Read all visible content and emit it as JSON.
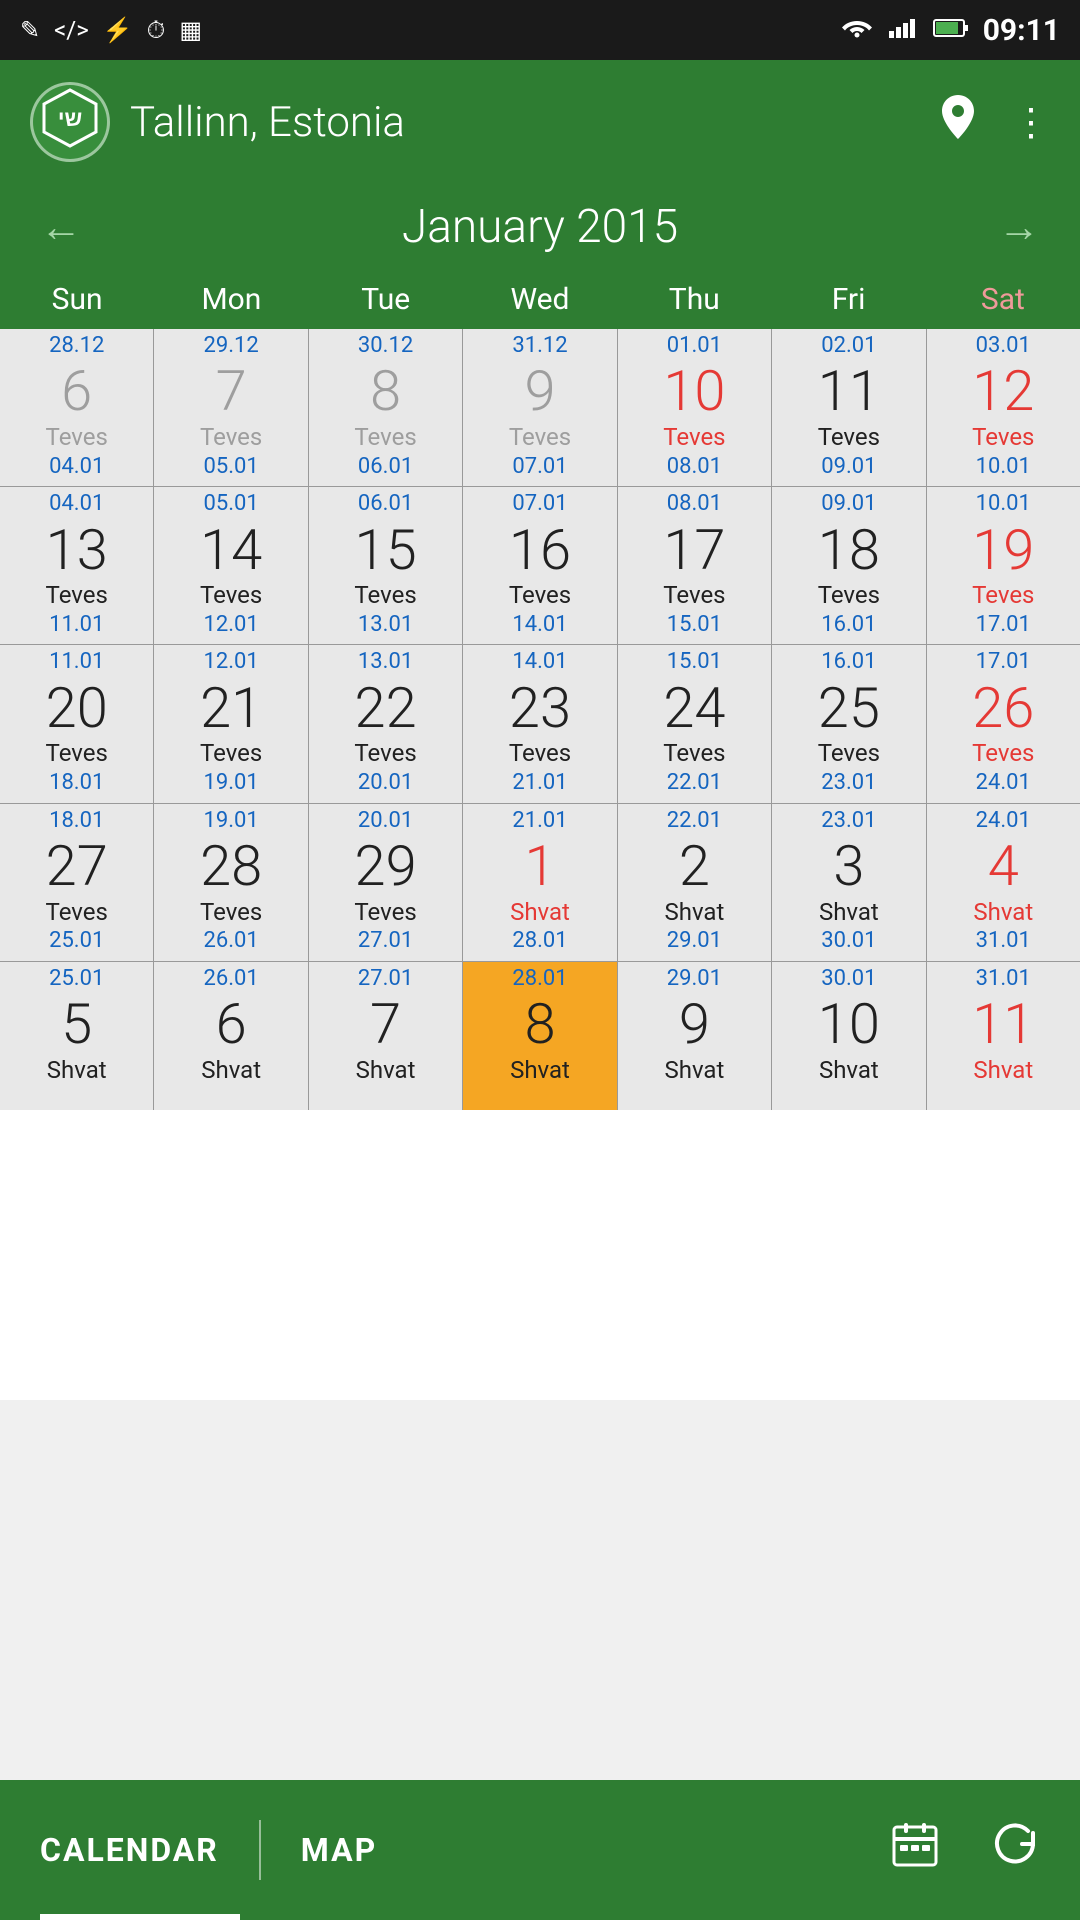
{
  "statusBar": {
    "time": "09:11",
    "leftIcons": [
      "✎",
      "</>",
      "⚡",
      "⏱",
      "▦"
    ],
    "rightIcons": [
      "wifi",
      "signal",
      "battery"
    ]
  },
  "header": {
    "city": "Tallinn, Estonia",
    "logoText": "שי"
  },
  "nav": {
    "monthTitle": "January 2015",
    "prevArrow": "←",
    "nextArrow": "→"
  },
  "dayHeaders": [
    {
      "label": "Sun",
      "class": ""
    },
    {
      "label": "Mon",
      "class": ""
    },
    {
      "label": "Tue",
      "class": ""
    },
    {
      "label": "Wed",
      "class": ""
    },
    {
      "label": "Thu",
      "class": ""
    },
    {
      "label": "Fri",
      "class": ""
    },
    {
      "label": "Sat",
      "class": "sat"
    }
  ],
  "weeks": [
    {
      "days": [
        {
          "topDate": "28.12",
          "num": "6",
          "numColor": "gray",
          "hebrew": "Teves",
          "hebColor": "gray",
          "bottomDate": "04.01",
          "isToday": false
        },
        {
          "topDate": "29.12",
          "num": "7",
          "numColor": "gray",
          "hebrew": "Teves",
          "hebColor": "gray",
          "bottomDate": "05.01",
          "isToday": false
        },
        {
          "topDate": "30.12",
          "num": "8",
          "numColor": "gray",
          "hebrew": "Teves",
          "hebColor": "gray",
          "bottomDate": "06.01",
          "isToday": false
        },
        {
          "topDate": "31.12",
          "num": "9",
          "numColor": "gray",
          "hebrew": "Teves",
          "hebColor": "gray",
          "bottomDate": "07.01",
          "isToday": false
        },
        {
          "topDate": "01.01",
          "num": "10",
          "numColor": "red",
          "hebrew": "Teves",
          "hebColor": "red",
          "bottomDate": "08.01",
          "isToday": false
        },
        {
          "topDate": "02.01",
          "num": "11",
          "numColor": "",
          "hebrew": "Teves",
          "hebColor": "",
          "bottomDate": "09.01",
          "isToday": false
        },
        {
          "topDate": "03.01",
          "num": "12",
          "numColor": "red",
          "hebrew": "Teves",
          "hebColor": "red",
          "bottomDate": "10.01",
          "isToday": false
        }
      ]
    },
    {
      "days": [
        {
          "topDate": "04.01",
          "num": "13",
          "numColor": "",
          "hebrew": "Teves",
          "hebColor": "",
          "bottomDate": "11.01",
          "isToday": false
        },
        {
          "topDate": "05.01",
          "num": "14",
          "numColor": "",
          "hebrew": "Teves",
          "hebColor": "",
          "bottomDate": "12.01",
          "isToday": false
        },
        {
          "topDate": "06.01",
          "num": "15",
          "numColor": "",
          "hebrew": "Teves",
          "hebColor": "",
          "bottomDate": "13.01",
          "isToday": false
        },
        {
          "topDate": "07.01",
          "num": "16",
          "numColor": "",
          "hebrew": "Teves",
          "hebColor": "",
          "bottomDate": "14.01",
          "isToday": false
        },
        {
          "topDate": "08.01",
          "num": "17",
          "numColor": "",
          "hebrew": "Teves",
          "hebColor": "",
          "bottomDate": "15.01",
          "isToday": false
        },
        {
          "topDate": "09.01",
          "num": "18",
          "numColor": "",
          "hebrew": "Teves",
          "hebColor": "",
          "bottomDate": "16.01",
          "isToday": false
        },
        {
          "topDate": "10.01",
          "num": "19",
          "numColor": "red",
          "hebrew": "Teves",
          "hebColor": "red",
          "bottomDate": "17.01",
          "isToday": false
        }
      ]
    },
    {
      "days": [
        {
          "topDate": "11.01",
          "num": "20",
          "numColor": "",
          "hebrew": "Teves",
          "hebColor": "",
          "bottomDate": "18.01",
          "isToday": false
        },
        {
          "topDate": "12.01",
          "num": "21",
          "numColor": "",
          "hebrew": "Teves",
          "hebColor": "",
          "bottomDate": "19.01",
          "isToday": false
        },
        {
          "topDate": "13.01",
          "num": "22",
          "numColor": "",
          "hebrew": "Teves",
          "hebColor": "",
          "bottomDate": "20.01",
          "isToday": false
        },
        {
          "topDate": "14.01",
          "num": "23",
          "numColor": "",
          "hebrew": "Teves",
          "hebColor": "",
          "bottomDate": "21.01",
          "isToday": false
        },
        {
          "topDate": "15.01",
          "num": "24",
          "numColor": "",
          "hebrew": "Teves",
          "hebColor": "",
          "bottomDate": "22.01",
          "isToday": false
        },
        {
          "topDate": "16.01",
          "num": "25",
          "numColor": "",
          "hebrew": "Teves",
          "hebColor": "",
          "bottomDate": "23.01",
          "isToday": false
        },
        {
          "topDate": "17.01",
          "num": "26",
          "numColor": "red",
          "hebrew": "Teves",
          "hebColor": "red",
          "bottomDate": "24.01",
          "isToday": false
        }
      ]
    },
    {
      "days": [
        {
          "topDate": "18.01",
          "num": "27",
          "numColor": "",
          "hebrew": "Teves",
          "hebColor": "",
          "bottomDate": "25.01",
          "isToday": false
        },
        {
          "topDate": "19.01",
          "num": "28",
          "numColor": "",
          "hebrew": "Teves",
          "hebColor": "",
          "bottomDate": "26.01",
          "isToday": false
        },
        {
          "topDate": "20.01",
          "num": "29",
          "numColor": "",
          "hebrew": "Teves",
          "hebColor": "",
          "bottomDate": "27.01",
          "isToday": false
        },
        {
          "topDate": "21.01",
          "num": "1",
          "numColor": "red",
          "hebrew": "Shvat",
          "hebColor": "red",
          "bottomDate": "28.01",
          "isToday": false
        },
        {
          "topDate": "22.01",
          "num": "2",
          "numColor": "",
          "hebrew": "Shvat",
          "hebColor": "",
          "bottomDate": "29.01",
          "isToday": false
        },
        {
          "topDate": "23.01",
          "num": "3",
          "numColor": "",
          "hebrew": "Shvat",
          "hebColor": "",
          "bottomDate": "30.01",
          "isToday": false
        },
        {
          "topDate": "24.01",
          "num": "4",
          "numColor": "red",
          "hebrew": "Shvat",
          "hebColor": "red",
          "bottomDate": "31.01",
          "isToday": false
        }
      ]
    },
    {
      "days": [
        {
          "topDate": "25.01",
          "num": "5",
          "numColor": "",
          "hebrew": "Shvat",
          "hebColor": "",
          "bottomDate": "",
          "isToday": false
        },
        {
          "topDate": "26.01",
          "num": "6",
          "numColor": "",
          "hebrew": "Shvat",
          "hebColor": "",
          "bottomDate": "",
          "isToday": false
        },
        {
          "topDate": "27.01",
          "num": "7",
          "numColor": "",
          "hebrew": "Shvat",
          "hebColor": "",
          "bottomDate": "",
          "isToday": false
        },
        {
          "topDate": "28.01",
          "num": "8",
          "numColor": "today",
          "hebrew": "Shvat",
          "hebColor": "today",
          "bottomDate": "",
          "isToday": true
        },
        {
          "topDate": "29.01",
          "num": "9",
          "numColor": "",
          "hebrew": "Shvat",
          "hebColor": "",
          "bottomDate": "",
          "isToday": false
        },
        {
          "topDate": "30.01",
          "num": "10",
          "numColor": "",
          "hebrew": "Shvat",
          "hebColor": "",
          "bottomDate": "",
          "isToday": false
        },
        {
          "topDate": "31.01",
          "num": "11",
          "numColor": "red",
          "hebrew": "Shvat",
          "hebColor": "red",
          "bottomDate": "",
          "isToday": false
        }
      ]
    }
  ],
  "bottomNav": {
    "calendarLabel": "CALENDAR",
    "mapLabel": "MAP",
    "calendarIcon": "📅",
    "refreshIcon": "↺"
  }
}
